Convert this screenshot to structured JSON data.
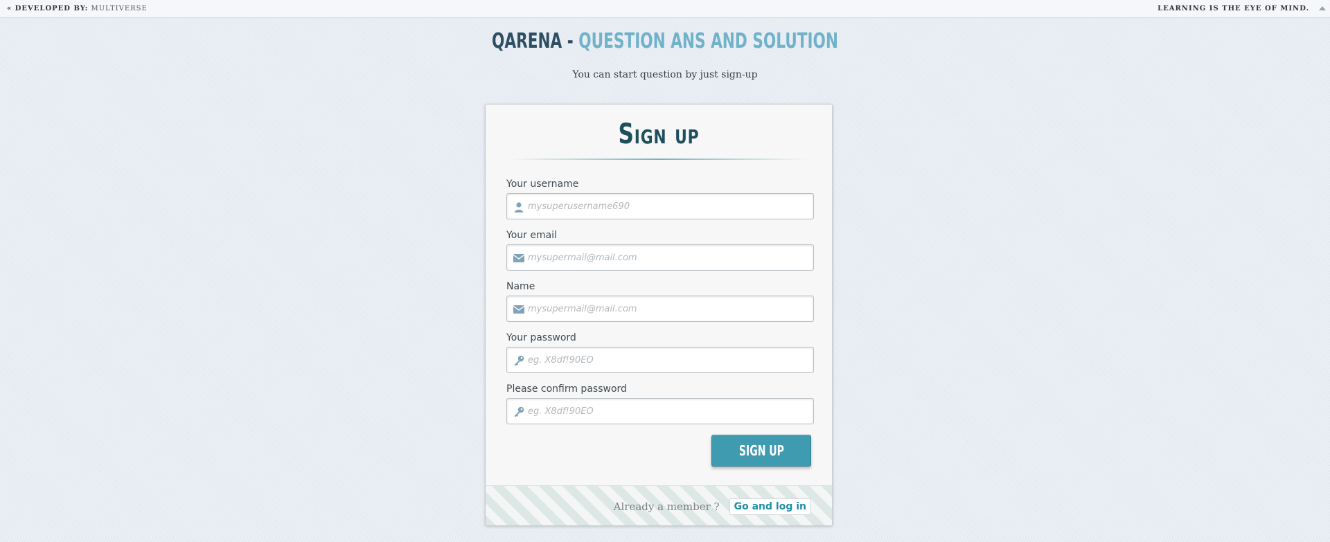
{
  "topbar": {
    "left_prefix": "« Developed by:",
    "left_name": "Multiverse",
    "right_text": "Learning is the eye of mind."
  },
  "header": {
    "title_part1": "QARENA",
    "title_dash": "-",
    "title_part2": "Question Ans and Solution",
    "subtitle": "You can start question by just sign-up"
  },
  "form": {
    "heading": "Sign up",
    "fields": [
      {
        "label": "Your username",
        "placeholder": "mysuperusername690",
        "icon": "user-icon"
      },
      {
        "label": "Your email",
        "placeholder": "mysupermail@mail.com",
        "icon": "envelope-icon"
      },
      {
        "label": "Name",
        "placeholder": "mysupermail@mail.com",
        "icon": "envelope-icon"
      },
      {
        "label": "Your password",
        "placeholder": "eg. X8df!90EO",
        "icon": "key-icon"
      },
      {
        "label": "Please confirm password",
        "placeholder": "eg. X8df!90EO",
        "icon": "key-icon"
      }
    ],
    "submit_label": "Sign up"
  },
  "footer": {
    "text": "Already a member ?",
    "login_label": "Go and log in"
  },
  "colors": {
    "accent": "#3f9bb0",
    "title_dark": "#2e4f63",
    "title_light": "#6fb2c9",
    "link": "#1c8fa6"
  }
}
